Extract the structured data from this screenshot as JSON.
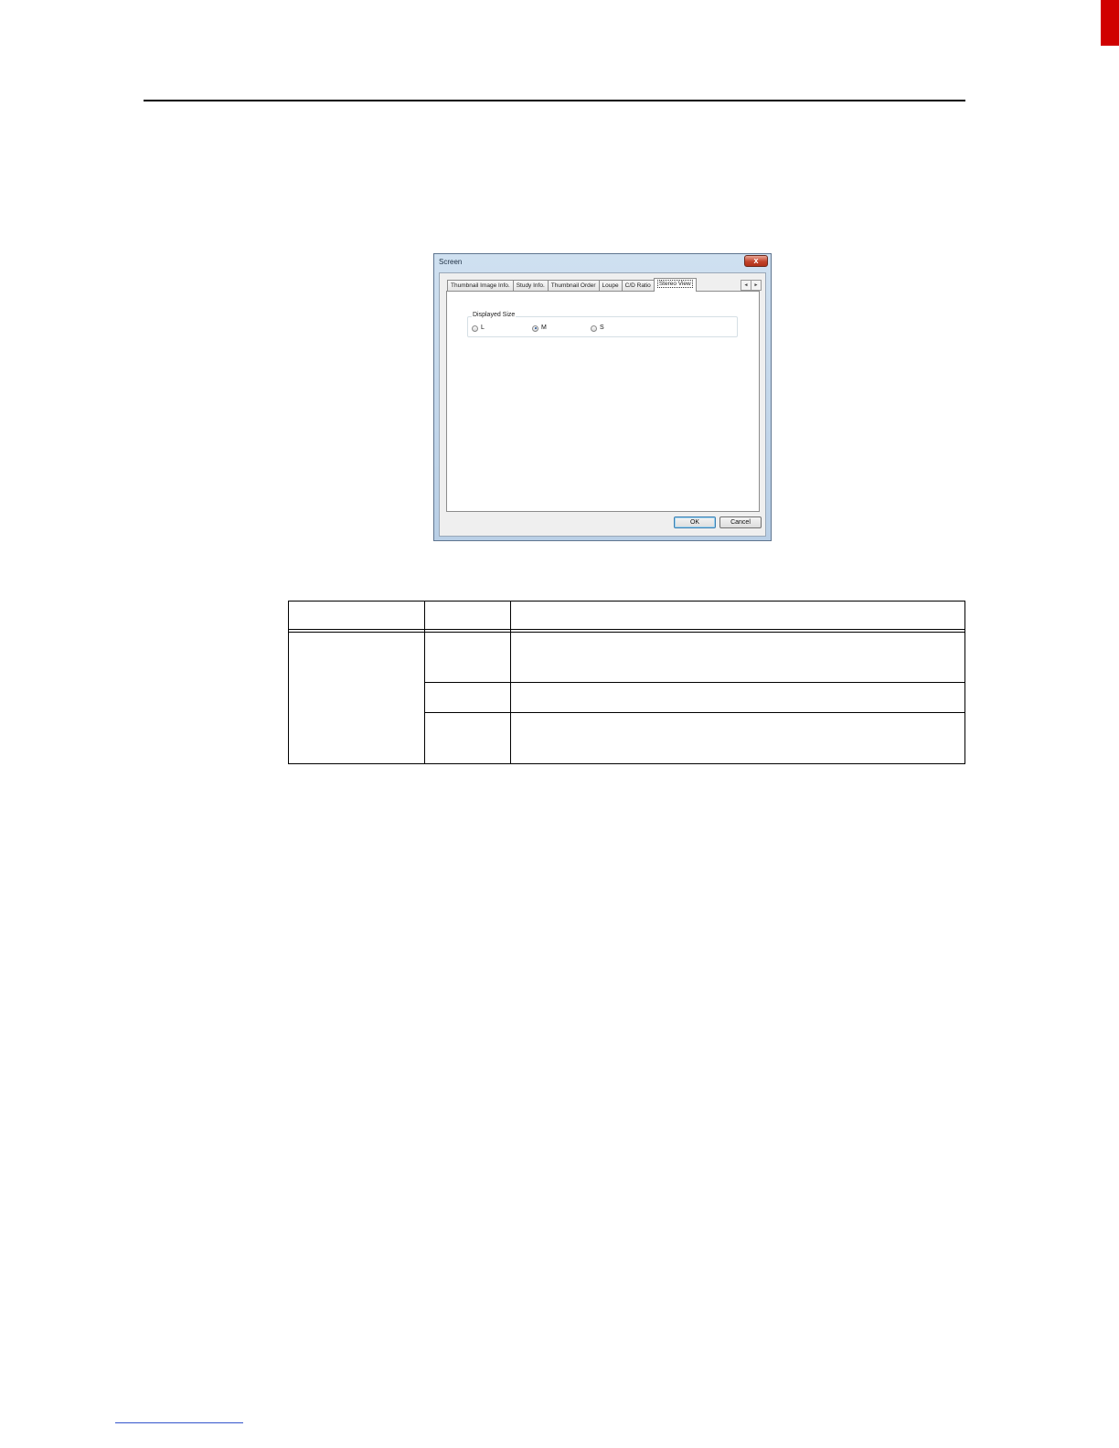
{
  "dialog": {
    "title": "Screen",
    "close_glyph": "x",
    "tabs": [
      "Thumbnail Image Info.",
      "Study Info.",
      "Thumbnail Order",
      "Loupe",
      "C/D Ratio",
      "Stereo View"
    ],
    "active_tab": "Stereo View",
    "tab_scroll": {
      "left": "◄",
      "right": "►"
    },
    "group": {
      "legend": "Displayed Size",
      "options": [
        "L",
        "M",
        "S"
      ],
      "selected": "M"
    },
    "buttons": {
      "ok": "OK",
      "cancel": "Cancel"
    }
  },
  "colors": {
    "side_tab": "#d00000",
    "footer_rule": "#3355cc"
  }
}
